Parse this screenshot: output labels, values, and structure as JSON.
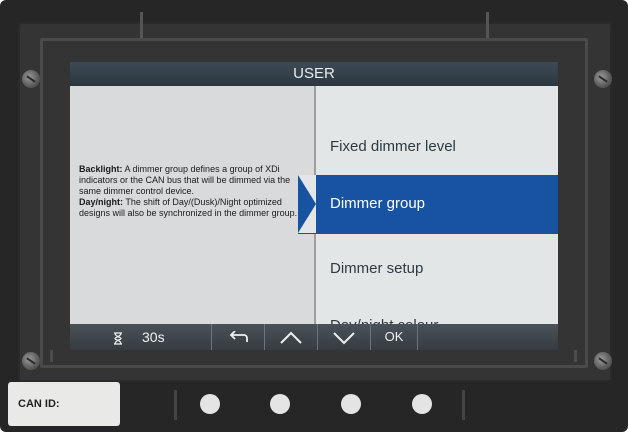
{
  "screen": {
    "title": "USER"
  },
  "help": {
    "backlight_label": "Backlight:",
    "backlight_text": " A dimmer group defines a group of XDi indicators or the CAN bus that will be dimmed via the same dimmer control device.",
    "daynight_label": "Day/night:",
    "daynight_text": " The shift of Day/(Dusk)/Night optimized designs will also be synchronized in the dimmer group."
  },
  "menu": {
    "items": [
      {
        "label": "Fixed dimmer level",
        "selected": false
      },
      {
        "label": "Dimmer group",
        "selected": true
      },
      {
        "label": "Dimmer setup",
        "selected": false
      },
      {
        "label": "Day/night colour",
        "selected": false
      }
    ]
  },
  "toolbar": {
    "timer_icon": "hourglass-icon",
    "timer_value": "30s",
    "back_icon": "back-arrow-icon",
    "up_icon": "chevron-up-icon",
    "down_icon": "chevron-down-icon",
    "ok_label": "OK"
  },
  "device": {
    "can_id_label": "CAN ID:"
  },
  "colors": {
    "selection": "#1753a0",
    "titlebar": "#2c3740",
    "left_panel": "#d9dadb",
    "right_panel": "#e3e6e7"
  }
}
